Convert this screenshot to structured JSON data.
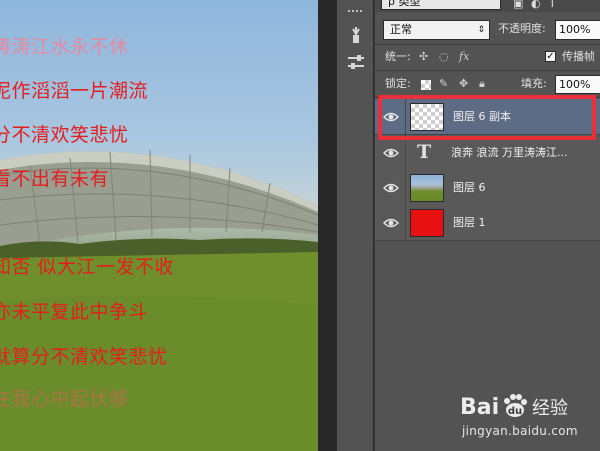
{
  "canvas": {
    "lines": [
      "涛涛江水永不休",
      "泥作滔滔一片潮流",
      "分不清欢笑悲忧",
      "看不出有未有",
      "知否 似大江一发不收",
      "亦未平复此中争斗",
      "就算分不清欢笑悲忧",
      "在我心中起伏够"
    ]
  },
  "panel": {
    "kind_label": "类型",
    "blend_mode": "正常",
    "opacity_label": "不透明度:",
    "opacity_value": "100%",
    "unify_label": "统一:",
    "propagate_label": "传播帧",
    "lock_label": "锁定:",
    "fill_label": "填充:",
    "fill_value": "100%",
    "layers": [
      {
        "name": "图层 6 副本",
        "type": "image",
        "thumb": "transparent",
        "selected": true,
        "visible": true
      },
      {
        "name": "浪奔 浪流 万里涛涛江...",
        "type": "text",
        "thumb": "text",
        "selected": false,
        "visible": true
      },
      {
        "name": "图层 6",
        "type": "image",
        "thumb": "photo",
        "selected": false,
        "visible": true
      },
      {
        "name": "图层 1",
        "type": "image",
        "thumb": "red",
        "selected": false,
        "visible": true
      }
    ]
  },
  "watermark": {
    "brand_left": "Bai",
    "brand_right": "经验",
    "url": "jingyan.baidu.com"
  },
  "colors": {
    "text_red": "#e51d1d",
    "selection_outline": "#e8303a",
    "selected_layer": "#5d6b84",
    "panel_bg": "#535353"
  }
}
